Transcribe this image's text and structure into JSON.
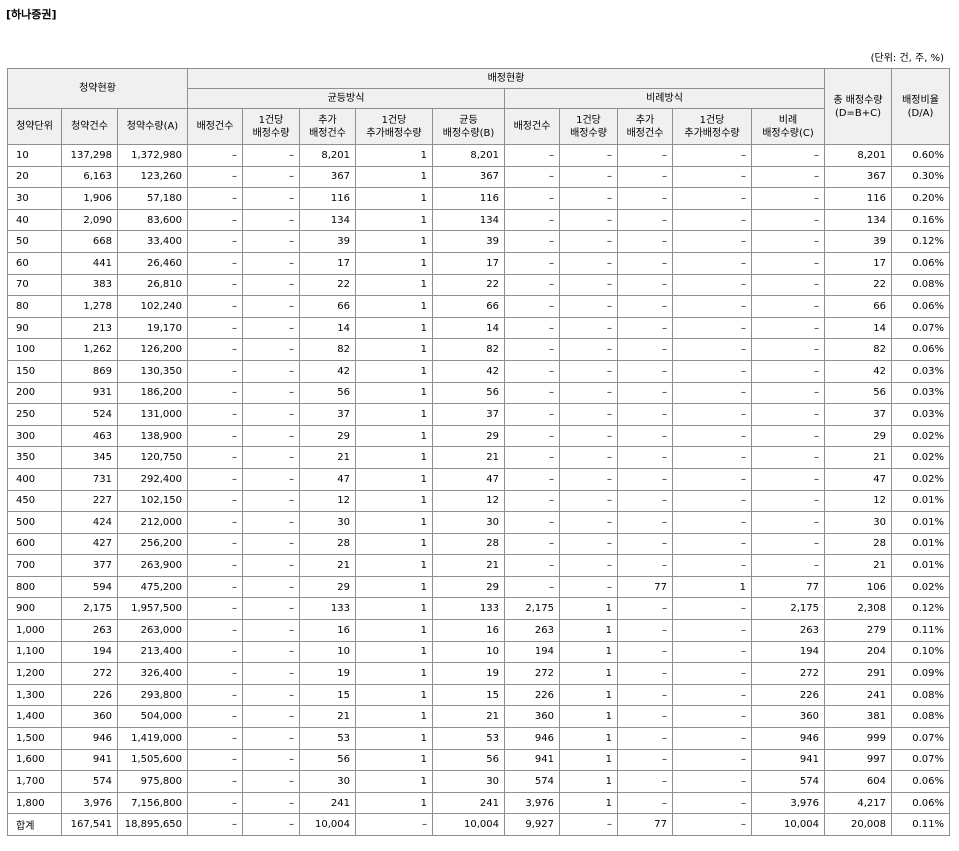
{
  "title": "[하나증권]",
  "unit_note": "(단위: 건, 주, %)",
  "headers": {
    "group_subscription": "청약현황",
    "group_allocation": "배정현황",
    "group_equal": "균등방식",
    "group_proportional": "비례방식",
    "total_alloc_line1": "총 배정수량",
    "total_alloc_line2": "(D=B+C)",
    "ratio_line1": "배정비율",
    "ratio_line2": "(D/A)",
    "col_unit": "청약단위",
    "col_count": "청약건수",
    "col_qty": "청약수량(A)",
    "col_eq_cnt": "배정건수",
    "col_eq_per_line1": "1건당",
    "col_eq_per_line2": "배정수량",
    "col_eq_add_cnt_line1": "추가",
    "col_eq_add_cnt_line2": "배정건수",
    "col_eq_add_per_line1": "1건당",
    "col_eq_add_per_line2": "추가배정수량",
    "col_eq_total_line1": "균등",
    "col_eq_total_line2": "배정수량(B)",
    "col_pr_cnt": "배정건수",
    "col_pr_per_line1": "1건당",
    "col_pr_per_line2": "배정수량",
    "col_pr_add_cnt_line1": "추가",
    "col_pr_add_cnt_line2": "배정건수",
    "col_pr_add_per_line1": "1건당",
    "col_pr_add_per_line2": "추가배정수량",
    "col_pr_total_line1": "비례",
    "col_pr_total_line2": "배정수량(C)"
  },
  "rows": [
    [
      "10",
      "137,298",
      "1,372,980",
      "–",
      "–",
      "8,201",
      "1",
      "8,201",
      "–",
      "–",
      "–",
      "–",
      "–",
      "8,201",
      "0.60%"
    ],
    [
      "20",
      "6,163",
      "123,260",
      "–",
      "–",
      "367",
      "1",
      "367",
      "–",
      "–",
      "–",
      "–",
      "–",
      "367",
      "0.30%"
    ],
    [
      "30",
      "1,906",
      "57,180",
      "–",
      "–",
      "116",
      "1",
      "116",
      "–",
      "–",
      "–",
      "–",
      "–",
      "116",
      "0.20%"
    ],
    [
      "40",
      "2,090",
      "83,600",
      "–",
      "–",
      "134",
      "1",
      "134",
      "–",
      "–",
      "–",
      "–",
      "–",
      "134",
      "0.16%"
    ],
    [
      "50",
      "668",
      "33,400",
      "–",
      "–",
      "39",
      "1",
      "39",
      "–",
      "–",
      "–",
      "–",
      "–",
      "39",
      "0.12%"
    ],
    [
      "60",
      "441",
      "26,460",
      "–",
      "–",
      "17",
      "1",
      "17",
      "–",
      "–",
      "–",
      "–",
      "–",
      "17",
      "0.06%"
    ],
    [
      "70",
      "383",
      "26,810",
      "–",
      "–",
      "22",
      "1",
      "22",
      "–",
      "–",
      "–",
      "–",
      "–",
      "22",
      "0.08%"
    ],
    [
      "80",
      "1,278",
      "102,240",
      "–",
      "–",
      "66",
      "1",
      "66",
      "–",
      "–",
      "–",
      "–",
      "–",
      "66",
      "0.06%"
    ],
    [
      "90",
      "213",
      "19,170",
      "–",
      "–",
      "14",
      "1",
      "14",
      "–",
      "–",
      "–",
      "–",
      "–",
      "14",
      "0.07%"
    ],
    [
      "100",
      "1,262",
      "126,200",
      "–",
      "–",
      "82",
      "1",
      "82",
      "–",
      "–",
      "–",
      "–",
      "–",
      "82",
      "0.06%"
    ],
    [
      "150",
      "869",
      "130,350",
      "–",
      "–",
      "42",
      "1",
      "42",
      "–",
      "–",
      "–",
      "–",
      "–",
      "42",
      "0.03%"
    ],
    [
      "200",
      "931",
      "186,200",
      "–",
      "–",
      "56",
      "1",
      "56",
      "–",
      "–",
      "–",
      "–",
      "–",
      "56",
      "0.03%"
    ],
    [
      "250",
      "524",
      "131,000",
      "–",
      "–",
      "37",
      "1",
      "37",
      "–",
      "–",
      "–",
      "–",
      "–",
      "37",
      "0.03%"
    ],
    [
      "300",
      "463",
      "138,900",
      "–",
      "–",
      "29",
      "1",
      "29",
      "–",
      "–",
      "–",
      "–",
      "–",
      "29",
      "0.02%"
    ],
    [
      "350",
      "345",
      "120,750",
      "–",
      "–",
      "21",
      "1",
      "21",
      "–",
      "–",
      "–",
      "–",
      "–",
      "21",
      "0.02%"
    ],
    [
      "400",
      "731",
      "292,400",
      "–",
      "–",
      "47",
      "1",
      "47",
      "–",
      "–",
      "–",
      "–",
      "–",
      "47",
      "0.02%"
    ],
    [
      "450",
      "227",
      "102,150",
      "–",
      "–",
      "12",
      "1",
      "12",
      "–",
      "–",
      "–",
      "–",
      "–",
      "12",
      "0.01%"
    ],
    [
      "500",
      "424",
      "212,000",
      "–",
      "–",
      "30",
      "1",
      "30",
      "–",
      "–",
      "–",
      "–",
      "–",
      "30",
      "0.01%"
    ],
    [
      "600",
      "427",
      "256,200",
      "–",
      "–",
      "28",
      "1",
      "28",
      "–",
      "–",
      "–",
      "–",
      "–",
      "28",
      "0.01%"
    ],
    [
      "700",
      "377",
      "263,900",
      "–",
      "–",
      "21",
      "1",
      "21",
      "–",
      "–",
      "–",
      "–",
      "–",
      "21",
      "0.01%"
    ],
    [
      "800",
      "594",
      "475,200",
      "–",
      "–",
      "29",
      "1",
      "29",
      "–",
      "–",
      "77",
      "1",
      "77",
      "106",
      "0.02%"
    ],
    [
      "900",
      "2,175",
      "1,957,500",
      "–",
      "–",
      "133",
      "1",
      "133",
      "2,175",
      "1",
      "–",
      "–",
      "2,175",
      "2,308",
      "0.12%"
    ],
    [
      "1,000",
      "263",
      "263,000",
      "–",
      "–",
      "16",
      "1",
      "16",
      "263",
      "1",
      "–",
      "–",
      "263",
      "279",
      "0.11%"
    ],
    [
      "1,100",
      "194",
      "213,400",
      "–",
      "–",
      "10",
      "1",
      "10",
      "194",
      "1",
      "–",
      "–",
      "194",
      "204",
      "0.10%"
    ],
    [
      "1,200",
      "272",
      "326,400",
      "–",
      "–",
      "19",
      "1",
      "19",
      "272",
      "1",
      "–",
      "–",
      "272",
      "291",
      "0.09%"
    ],
    [
      "1,300",
      "226",
      "293,800",
      "–",
      "–",
      "15",
      "1",
      "15",
      "226",
      "1",
      "–",
      "–",
      "226",
      "241",
      "0.08%"
    ],
    [
      "1,400",
      "360",
      "504,000",
      "–",
      "–",
      "21",
      "1",
      "21",
      "360",
      "1",
      "–",
      "–",
      "360",
      "381",
      "0.08%"
    ],
    [
      "1,500",
      "946",
      "1,419,000",
      "–",
      "–",
      "53",
      "1",
      "53",
      "946",
      "1",
      "–",
      "–",
      "946",
      "999",
      "0.07%"
    ],
    [
      "1,600",
      "941",
      "1,505,600",
      "–",
      "–",
      "56",
      "1",
      "56",
      "941",
      "1",
      "–",
      "–",
      "941",
      "997",
      "0.07%"
    ],
    [
      "1,700",
      "574",
      "975,800",
      "–",
      "–",
      "30",
      "1",
      "30",
      "574",
      "1",
      "–",
      "–",
      "574",
      "604",
      "0.06%"
    ],
    [
      "1,800",
      "3,976",
      "7,156,800",
      "–",
      "–",
      "241",
      "1",
      "241",
      "3,976",
      "1",
      "–",
      "–",
      "3,976",
      "4,217",
      "0.06%"
    ]
  ],
  "total_row": [
    "합계",
    "167,541",
    "18,895,650",
    "–",
    "–",
    "10,004",
    "–",
    "10,004",
    "9,927",
    "–",
    "77",
    "–",
    "10,004",
    "20,008",
    "0.11%"
  ]
}
